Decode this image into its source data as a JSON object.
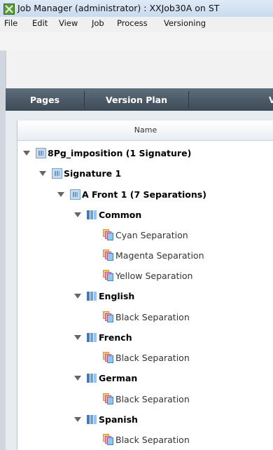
{
  "window": {
    "title": "Job Manager (administrator) : XXJob30A on ST"
  },
  "menu": [
    "File",
    "Edit",
    "View",
    "Job",
    "Process",
    "Versioning"
  ],
  "tabs": [
    "Pages",
    "Version Plan",
    "V"
  ],
  "tree": {
    "column_header": "Name",
    "nodes": [
      {
        "label": "8Pg_imposition (1 Signature)",
        "icon": "imposition-icon"
      },
      {
        "label": "Signature 1",
        "icon": "signature-icon"
      },
      {
        "label": "A Front 1 (7 Separations)",
        "icon": "surface-icon"
      },
      {
        "label": "Common",
        "icon": "version-icon"
      },
      {
        "label": "Cyan Separation",
        "icon": "separation-icon"
      },
      {
        "label": "Magenta Separation",
        "icon": "separation-icon"
      },
      {
        "label": "Yellow Separation",
        "icon": "separation-icon"
      },
      {
        "label": "English",
        "icon": "version-icon"
      },
      {
        "label": "Black Separation",
        "icon": "separation-icon"
      },
      {
        "label": "French",
        "icon": "version-icon"
      },
      {
        "label": "Black Separation",
        "icon": "separation-icon"
      },
      {
        "label": "German",
        "icon": "version-icon"
      },
      {
        "label": "Black Separation",
        "icon": "separation-icon"
      },
      {
        "label": "Spanish",
        "icon": "version-icon"
      },
      {
        "label": "Black Separation",
        "icon": "separation-icon"
      }
    ]
  }
}
